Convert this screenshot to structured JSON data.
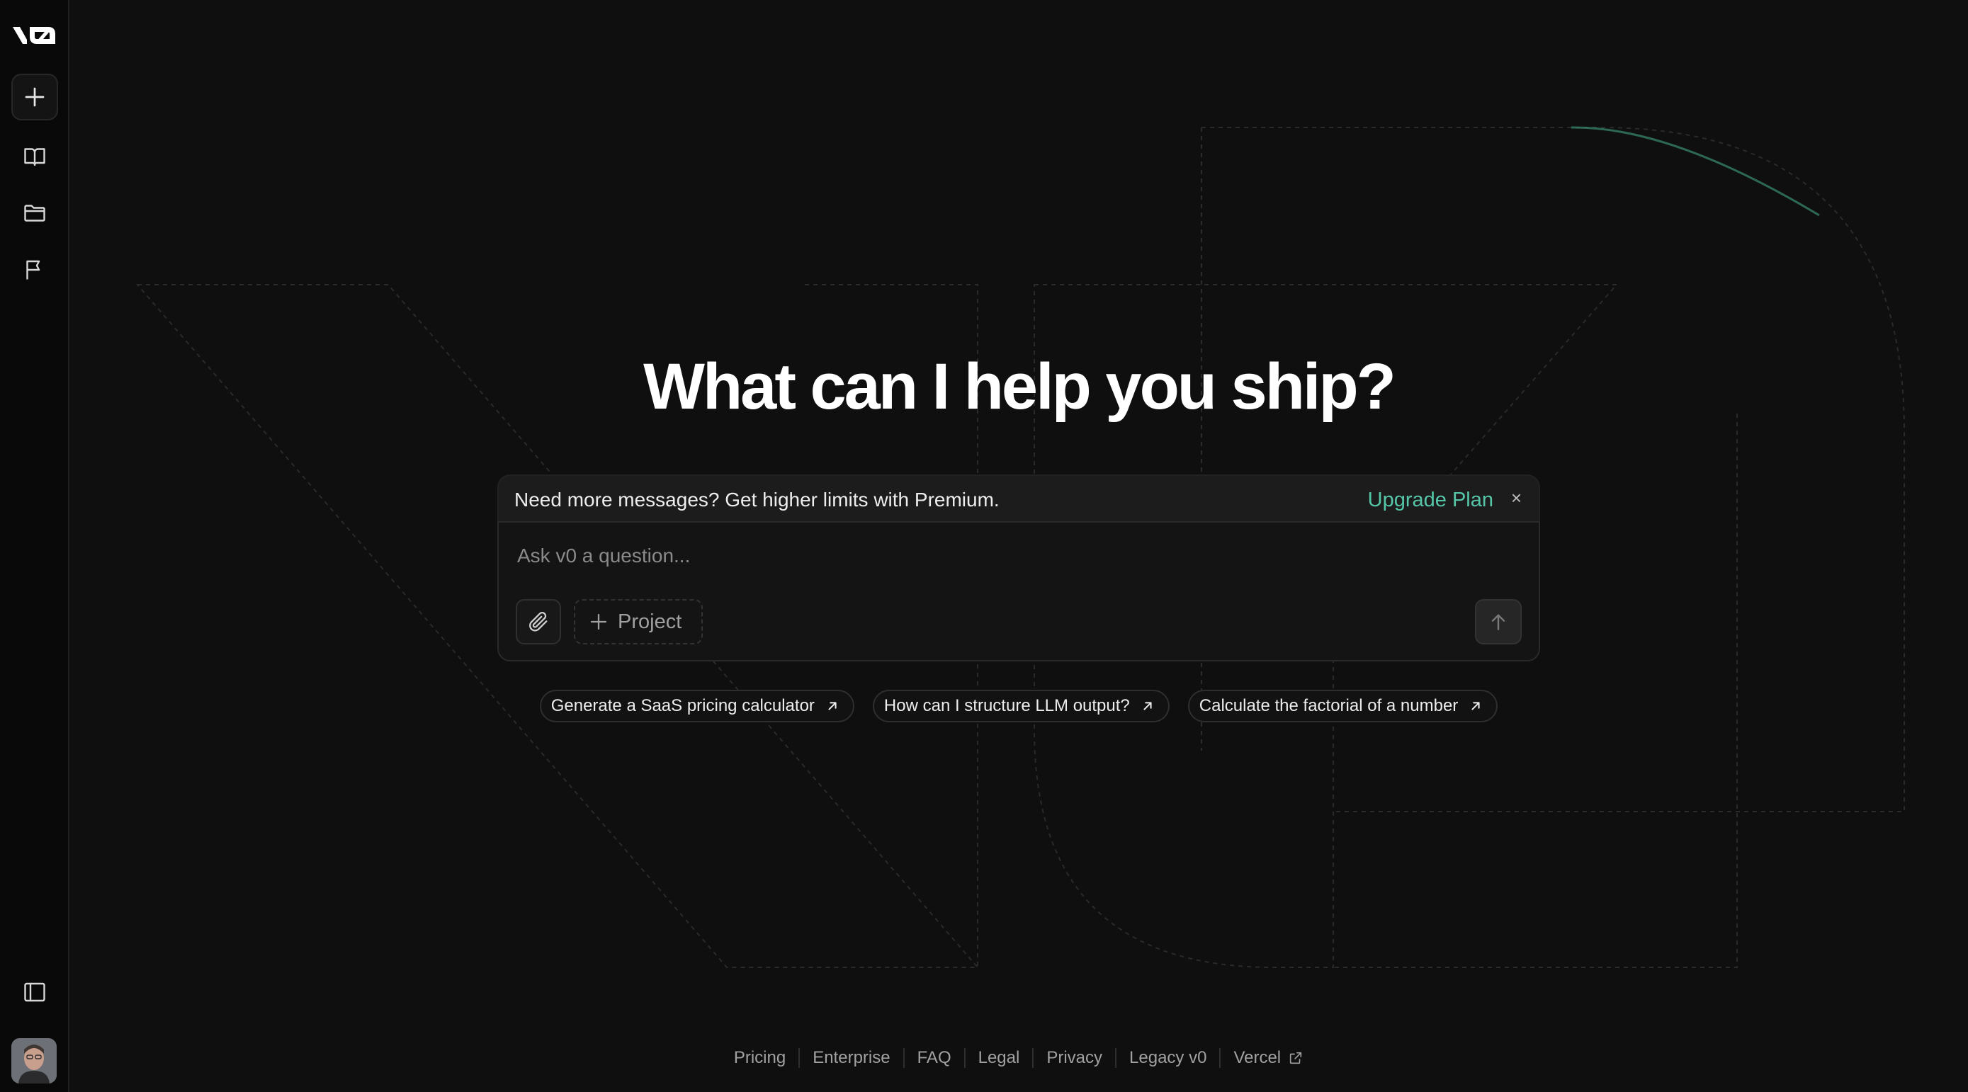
{
  "brand": {
    "logo_text": "v0"
  },
  "sidebar": {
    "items": [
      {
        "name": "new-chat",
        "icon": "plus-icon"
      },
      {
        "name": "library",
        "icon": "book-icon"
      },
      {
        "name": "projects",
        "icon": "folder-icon"
      },
      {
        "name": "feedback",
        "icon": "flag-icon"
      }
    ],
    "bottom": {
      "toggle_icon": "sidebar-toggle-icon",
      "avatar": "user-avatar"
    }
  },
  "hero": {
    "title": "What can I help you ship?"
  },
  "banner": {
    "message": "Need more messages? Get higher limits with Premium.",
    "upgrade_label": "Upgrade Plan",
    "close_symbol": "×"
  },
  "composer": {
    "placeholder": "Ask v0 a question...",
    "project_label": "Project",
    "attach_icon": "paperclip-icon",
    "send_icon": "arrow-up-icon"
  },
  "suggestions": [
    {
      "label": "Generate a SaaS pricing calculator"
    },
    {
      "label": "How can I structure LLM output?"
    },
    {
      "label": "Calculate the factorial of a number"
    }
  ],
  "footer": {
    "links": [
      "Pricing",
      "Enterprise",
      "FAQ",
      "Legal",
      "Privacy",
      "Legacy v0",
      "Vercel"
    ]
  },
  "colors": {
    "accent": "#55c7a8",
    "background": "#0f0f0f",
    "sidebar": "#090909"
  }
}
